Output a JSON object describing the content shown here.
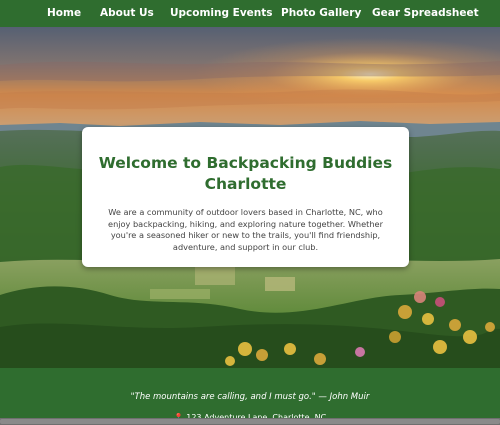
{
  "nav": {
    "items": [
      {
        "label": "Home"
      },
      {
        "label": "About Us"
      },
      {
        "label": "Upcoming Events"
      },
      {
        "label": "Photo Gallery"
      },
      {
        "label": "Gear Spreadsheet"
      }
    ]
  },
  "hero": {
    "title": "Welcome to Backpacking Buddies Charlotte",
    "description": "We are a community of outdoor lovers based in Charlotte, NC, who enjoy backpacking, hiking, and exploring nature together. Whether you're a seasoned hiker or new to the trails, you'll find friendship, adventure, and support in our club."
  },
  "footer": {
    "quote": "\"The mountains are calling, and I must go.\" — John Muir",
    "pin_icon": "📍",
    "address": "123 Adventure Lane, Charlotte, NC"
  },
  "colors": {
    "brand_green": "#2f6d2f",
    "title_green": "#2f6d2f"
  }
}
